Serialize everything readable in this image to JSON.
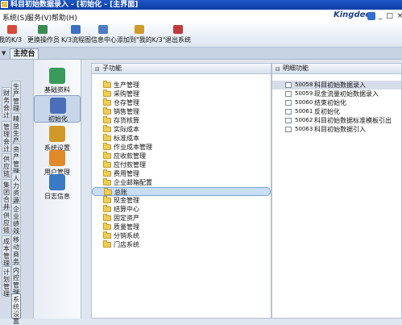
{
  "window": {
    "title": "科目初始数据录入 - [初始化 - [主界面]"
  },
  "menu": [
    {
      "label": "系统(S)"
    },
    {
      "label": "服务(V)"
    },
    {
      "label": "帮助(H)"
    }
  ],
  "brand": {
    "name": "Kingdee",
    "window_controls": "_ □ ×",
    "side_link": "请"
  },
  "toolbar": [
    {
      "label": "我的K/3",
      "icon": "home-icon",
      "color": "#d64a3a"
    },
    {
      "label": "更换操作员",
      "icon": "user-switch-icon",
      "color": "#3a8a4f"
    },
    {
      "label": "K/3流程图",
      "icon": "flowchart-icon",
      "color": "#3f6fc4"
    },
    {
      "label": "信息中心",
      "icon": "message-icon",
      "color": "#4e7bbf"
    },
    {
      "label": "添加到\"我的K/3\"",
      "icon": "add-favorite-icon",
      "color": "#d09a2a"
    },
    {
      "label": "退出系统",
      "icon": "exit-icon",
      "color": "#c33a3a"
    }
  ],
  "tabs": {
    "main": "主控台"
  },
  "categories": [
    {
      "label": "生产管理"
    },
    {
      "label": "财务会计"
    },
    {
      "label": "精益生产"
    },
    {
      "label": "管理会计"
    },
    {
      "label": "资产管理"
    },
    {
      "label": "供应链"
    },
    {
      "label": "人力资源"
    },
    {
      "label": "集团合并"
    },
    {
      "label": "企业绩效"
    },
    {
      "label": "供应链"
    },
    {
      "label": "移动商务"
    },
    {
      "label": "成本管理"
    },
    {
      "label": "内控管理"
    },
    {
      "label": "计划管理"
    },
    {
      "label": "系统设置"
    }
  ],
  "functions": [
    {
      "label": "基础资料",
      "icon": "basic-data-icon",
      "color": "#3a9a5a"
    },
    {
      "label": "初始化",
      "icon": "initialize-icon",
      "color": "#4a6fb8",
      "selected": true
    },
    {
      "label": "系统设置",
      "icon": "system-settings-icon",
      "color": "#d09a2a"
    },
    {
      "label": "用户管理",
      "icon": "user-management-icon",
      "color": "#e08a2a"
    },
    {
      "label": "日志信息",
      "icon": "log-info-icon",
      "color": "#3a7ac4"
    }
  ],
  "sub_pane": {
    "header": "子功能",
    "items": [
      {
        "label": "生产管理"
      },
      {
        "label": "采购管理"
      },
      {
        "label": "仓存管理"
      },
      {
        "label": "销售管理"
      },
      {
        "label": "存货核算"
      },
      {
        "label": "实际成本"
      },
      {
        "label": "标准成本"
      },
      {
        "label": "作业成本管理"
      },
      {
        "label": "应收款管理"
      },
      {
        "label": "应付款管理"
      },
      {
        "label": "费用管理"
      },
      {
        "label": "企业邮箱配置"
      },
      {
        "label": "总账",
        "selected": true
      },
      {
        "label": "现金管理"
      },
      {
        "label": "结算中心"
      },
      {
        "label": "固定资产"
      },
      {
        "label": "质量管理"
      },
      {
        "label": "分销系统"
      },
      {
        "label": "门店系统"
      }
    ]
  },
  "detail_pane": {
    "header": "明细功能",
    "items": [
      {
        "code": "50058",
        "label": "科目初始数据录入",
        "selected": true
      },
      {
        "code": "50059",
        "label": "现金流量初始数据录入"
      },
      {
        "code": "50060",
        "label": "结束初始化"
      },
      {
        "code": "50061",
        "label": "反初始化"
      },
      {
        "code": "50062",
        "label": "科目初始数据标准模板引出"
      },
      {
        "code": "50063",
        "label": "科目初始数据引入"
      }
    ]
  }
}
